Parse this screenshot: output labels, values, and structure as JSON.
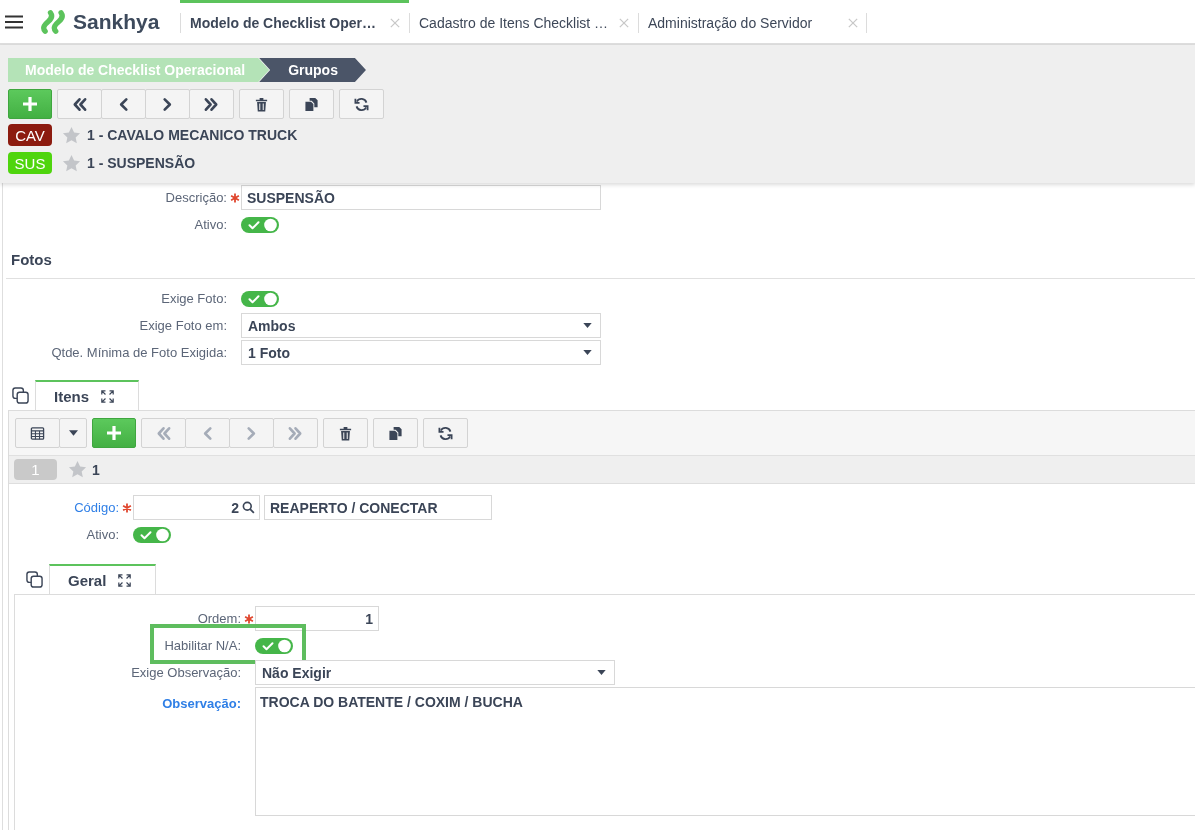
{
  "top_bar": {
    "logo": "Sankhya",
    "tabs": [
      {
        "label": "Modelo de Checklist Oper…",
        "selected": true
      },
      {
        "label": "Cadastro de Itens Checklist …",
        "selected": false
      },
      {
        "label": "Administração do Servidor",
        "selected": false
      }
    ]
  },
  "breadcrumb": [
    {
      "label": "Modelo de Checklist Operacional",
      "selected": false
    },
    {
      "label": "Grupos",
      "selected": true
    }
  ],
  "toolbar": {
    "groups": [
      {
        "buttons": [
          {
            "kind": "add",
            "disabled": false
          }
        ]
      },
      {
        "buttons": [
          {
            "kind": "first",
            "disabled": false
          },
          {
            "kind": "previous",
            "disabled": false
          },
          {
            "kind": "next",
            "disabled": false
          },
          {
            "kind": "last",
            "disabled": false
          }
        ]
      },
      {
        "buttons": [
          {
            "kind": "delete",
            "disabled": false
          }
        ]
      },
      {
        "buttons": [
          {
            "kind": "duplicate",
            "disabled": false
          }
        ]
      },
      {
        "buttons": [
          {
            "kind": "refresh",
            "disabled": false
          }
        ]
      }
    ]
  },
  "records": [
    {
      "badge": "CAV",
      "color": "#8c1b0f",
      "favorite": false,
      "title": "1 - CAVALO MECANICO TRUCK"
    },
    {
      "badge": "SUS",
      "color": "#4fd50e",
      "favorite": false,
      "title": "1 - SUSPENSÃO"
    }
  ],
  "form": {
    "fields": [
      {
        "kind": "text",
        "label": "Descrição:",
        "link": false,
        "required": true,
        "highlighted": false,
        "value": "SUSPENSÃO"
      },
      {
        "kind": "toggle",
        "label": "Ativo:",
        "link": false,
        "required": false,
        "highlighted": false,
        "on": true
      }
    ],
    "sections": [
      {
        "title": "Fotos",
        "fields": [
          {
            "kind": "toggle",
            "label": "Exige Foto:",
            "link": false,
            "required": false,
            "highlighted": false,
            "on": true
          },
          {
            "kind": "select",
            "label": "Exige Foto em:",
            "link": false,
            "required": false,
            "highlighted": false,
            "value": "Ambos"
          },
          {
            "kind": "select",
            "label": "Qtde. Mínima de Foto Exigida:",
            "link": false,
            "required": false,
            "highlighted": false,
            "value": "1 Foto"
          }
        ]
      }
    ]
  },
  "itens": {
    "tab": {
      "label": "Itens",
      "selected": true
    },
    "toolbar": {
      "groups": [
        {
          "buttons": [
            {
              "kind": "grid",
              "disabled": false
            },
            {
              "kind": "dropdown",
              "disabled": false
            }
          ]
        },
        {
          "buttons": [
            {
              "kind": "add",
              "disabled": false
            }
          ]
        },
        {
          "buttons": [
            {
              "kind": "first",
              "disabled": true
            },
            {
              "kind": "previous",
              "disabled": true
            },
            {
              "kind": "next",
              "disabled": true
            },
            {
              "kind": "last",
              "disabled": true
            }
          ]
        },
        {
          "buttons": [
            {
              "kind": "delete",
              "disabled": false
            }
          ]
        },
        {
          "buttons": [
            {
              "kind": "duplicate",
              "disabled": false
            }
          ]
        },
        {
          "buttons": [
            {
              "kind": "refresh",
              "disabled": false
            }
          ]
        }
      ]
    },
    "records": [
      {
        "badge": "1",
        "color": "#c9c9c9",
        "favorite": false,
        "title": "1"
      }
    ],
    "fields": [
      {
        "kind": "lookup",
        "label": "Código:",
        "link": true,
        "required": true,
        "highlighted": false,
        "value": "2",
        "description": "REAPERTO / CONECTAR"
      },
      {
        "kind": "toggle",
        "label": "Ativo:",
        "link": false,
        "required": false,
        "highlighted": false,
        "on": true
      }
    ],
    "geral": {
      "tab": {
        "label": "Geral",
        "selected": true
      },
      "fields": [
        {
          "kind": "number",
          "label": "Ordem:",
          "link": false,
          "required": true,
          "highlighted": false,
          "value": "1"
        },
        {
          "kind": "toggle",
          "label": "Habilitar N/A:",
          "link": false,
          "required": false,
          "highlighted": true,
          "on": true
        },
        {
          "kind": "select",
          "label": "Exige Observação:",
          "link": false,
          "required": false,
          "highlighted": false,
          "value": "Não Exigir"
        },
        {
          "kind": "textarea",
          "label": "Observação:",
          "link": true,
          "required": false,
          "highlighted": false,
          "value": "TROCA DO BATENTE / COXIM / BUCHA"
        }
      ]
    }
  }
}
